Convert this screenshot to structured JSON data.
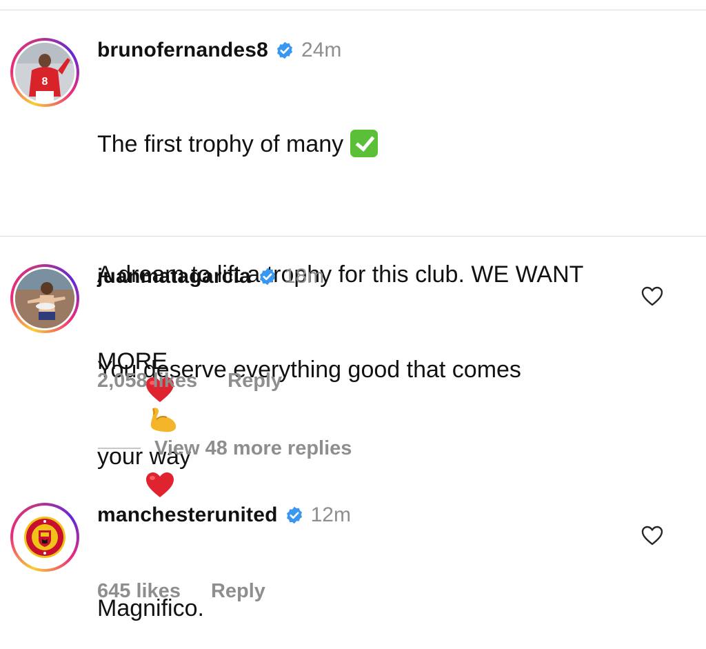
{
  "caption": {
    "username": "brunofernandes8",
    "time": "24m",
    "line1": "The first trophy of many",
    "line2": "A dream to lift a trophy for this club. WE WANT",
    "line3": "MORE",
    "avatar_jersey_number": "8"
  },
  "comments": [
    {
      "username": "juanmatagarcia",
      "time": "18m",
      "text_line1": "You deserve everything good that comes",
      "text_line2": "your way",
      "likes": "2,058 likes",
      "reply": "Reply",
      "view_more": "View 48 more replies"
    },
    {
      "username": "manchesterunited",
      "time": "12m",
      "text": "Magnifico.",
      "likes": "645 likes",
      "reply": "Reply"
    }
  ],
  "colors": {
    "verified": "#3897f0",
    "secondary_text": "#8e8e8e",
    "heart_emoji": "#e0242f",
    "check_emoji": "#5cbf3a"
  },
  "icons": {
    "verified": "verified-badge-icon",
    "like": "heart-outline-icon",
    "check_emoji": "check-mark-button-emoji",
    "heart_emoji": "red-heart-emoji",
    "muscle_emoji": "flexed-biceps-emoji"
  }
}
